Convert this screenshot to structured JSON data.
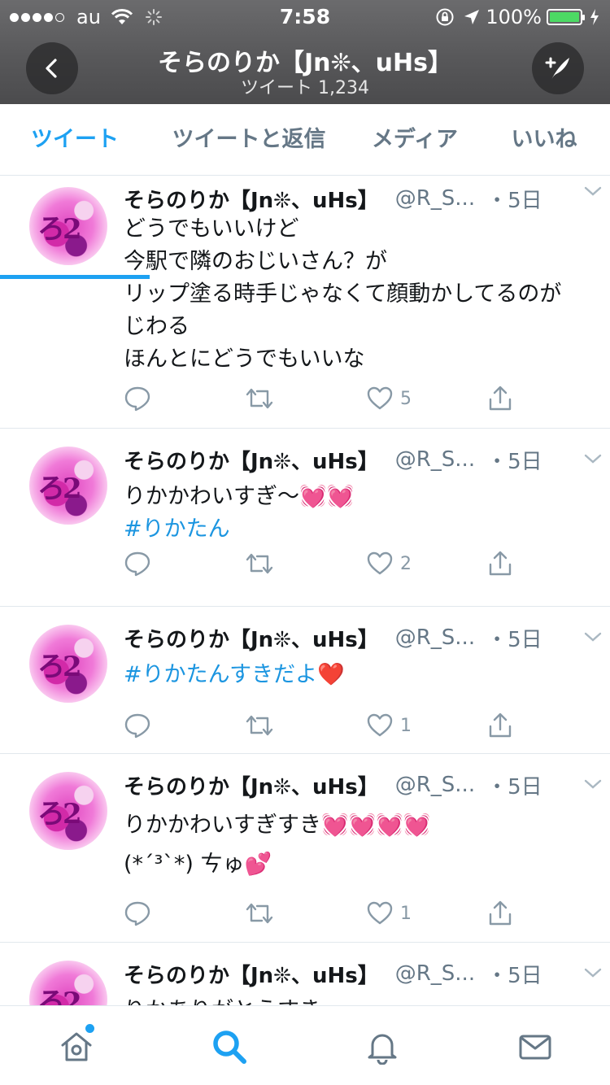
{
  "status_bar": {
    "carrier": "au",
    "time": "7:58",
    "battery": "100%",
    "battery_color": "#4cd964"
  },
  "header": {
    "back_icon": "back-arrow-icon",
    "title": "そらのりか【Jn❊、uHs】",
    "subtitle": "ツイート 1,234",
    "compose_icon": "compose-tweet-icon"
  },
  "tabs": [
    {
      "label": "ツイート",
      "active": true
    },
    {
      "label": "ツイートと返信",
      "active": false
    },
    {
      "label": "メディア",
      "active": false
    },
    {
      "label": "いいね",
      "active": false
    }
  ],
  "colors": {
    "accent": "#1da1f2",
    "hashtag": "#1b95e0",
    "secondary_text": "#657786",
    "action_icon": "#8899a6"
  },
  "tweets": [
    {
      "name": "そらのりか【Jn❊、uHs】",
      "handle": "@R_S...",
      "time": "・5日",
      "lines": [
        "どうでもいいけど",
        "今駅で隣のおじいさん？が",
        "リップ塗る時手じゃなくて顔動かしてるのが",
        "じわる",
        "ほんとにどうでもいいな"
      ],
      "hashtag": "",
      "reply_count": "",
      "retweet_count": "",
      "like_count": "5"
    },
    {
      "name": "そらのりか【Jn❊、uHs】",
      "handle": "@R_S...",
      "time": "・5日",
      "lines": [
        "りかかわいすぎ〜💓💓"
      ],
      "hashtag": "#りかたん",
      "reply_count": "",
      "retweet_count": "",
      "like_count": "2"
    },
    {
      "name": "そらのりか【Jn❊、uHs】",
      "handle": "@R_S...",
      "time": "・5日",
      "lines": [],
      "hashtag": "#りかたんすきだよ❤️",
      "reply_count": "",
      "retweet_count": "",
      "like_count": "1"
    },
    {
      "name": "そらのりか【Jn❊、uHs】",
      "handle": "@R_S...",
      "time": "・5日",
      "lines": [
        "りかかわいすぎすき💓💓💓💓",
        "(*´³`*) ㄘゅ💕"
      ],
      "hashtag": "",
      "reply_count": "",
      "retweet_count": "",
      "like_count": "1"
    },
    {
      "name": "そらのりか【Jn❊、uHs】",
      "handle": "@R_S...",
      "time": "・5日",
      "lines": [
        "りかありがとうすき"
      ],
      "hashtag": "",
      "reply_count": "",
      "retweet_count": "",
      "like_count": ""
    }
  ],
  "bottom_nav": [
    {
      "icon": "home-icon",
      "active": false,
      "badge": true
    },
    {
      "icon": "search-icon",
      "active": true,
      "badge": false
    },
    {
      "icon": "notifications-bell-icon",
      "active": false,
      "badge": false
    },
    {
      "icon": "messages-envelope-icon",
      "active": false,
      "badge": false
    }
  ]
}
